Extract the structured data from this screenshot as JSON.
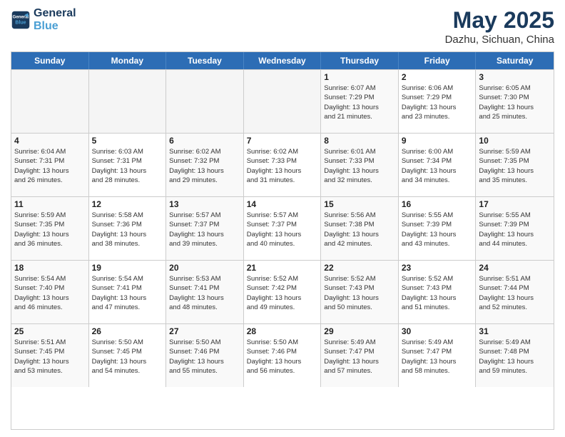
{
  "header": {
    "logo_line1": "General",
    "logo_line2": "Blue",
    "month_title": "May 2025",
    "location": "Dazhu, Sichuan, China"
  },
  "days_of_week": [
    "Sunday",
    "Monday",
    "Tuesday",
    "Wednesday",
    "Thursday",
    "Friday",
    "Saturday"
  ],
  "weeks": [
    [
      {
        "day": "",
        "empty": true,
        "info": ""
      },
      {
        "day": "",
        "empty": true,
        "info": ""
      },
      {
        "day": "",
        "empty": true,
        "info": ""
      },
      {
        "day": "",
        "empty": true,
        "info": ""
      },
      {
        "day": "1",
        "empty": false,
        "info": "Sunrise: 6:07 AM\nSunset: 7:29 PM\nDaylight: 13 hours\nand 21 minutes."
      },
      {
        "day": "2",
        "empty": false,
        "info": "Sunrise: 6:06 AM\nSunset: 7:29 PM\nDaylight: 13 hours\nand 23 minutes."
      },
      {
        "day": "3",
        "empty": false,
        "info": "Sunrise: 6:05 AM\nSunset: 7:30 PM\nDaylight: 13 hours\nand 25 minutes."
      }
    ],
    [
      {
        "day": "4",
        "empty": false,
        "info": "Sunrise: 6:04 AM\nSunset: 7:31 PM\nDaylight: 13 hours\nand 26 minutes."
      },
      {
        "day": "5",
        "empty": false,
        "info": "Sunrise: 6:03 AM\nSunset: 7:31 PM\nDaylight: 13 hours\nand 28 minutes."
      },
      {
        "day": "6",
        "empty": false,
        "info": "Sunrise: 6:02 AM\nSunset: 7:32 PM\nDaylight: 13 hours\nand 29 minutes."
      },
      {
        "day": "7",
        "empty": false,
        "info": "Sunrise: 6:02 AM\nSunset: 7:33 PM\nDaylight: 13 hours\nand 31 minutes."
      },
      {
        "day": "8",
        "empty": false,
        "info": "Sunrise: 6:01 AM\nSunset: 7:33 PM\nDaylight: 13 hours\nand 32 minutes."
      },
      {
        "day": "9",
        "empty": false,
        "info": "Sunrise: 6:00 AM\nSunset: 7:34 PM\nDaylight: 13 hours\nand 34 minutes."
      },
      {
        "day": "10",
        "empty": false,
        "info": "Sunrise: 5:59 AM\nSunset: 7:35 PM\nDaylight: 13 hours\nand 35 minutes."
      }
    ],
    [
      {
        "day": "11",
        "empty": false,
        "info": "Sunrise: 5:59 AM\nSunset: 7:35 PM\nDaylight: 13 hours\nand 36 minutes."
      },
      {
        "day": "12",
        "empty": false,
        "info": "Sunrise: 5:58 AM\nSunset: 7:36 PM\nDaylight: 13 hours\nand 38 minutes."
      },
      {
        "day": "13",
        "empty": false,
        "info": "Sunrise: 5:57 AM\nSunset: 7:37 PM\nDaylight: 13 hours\nand 39 minutes."
      },
      {
        "day": "14",
        "empty": false,
        "info": "Sunrise: 5:57 AM\nSunset: 7:37 PM\nDaylight: 13 hours\nand 40 minutes."
      },
      {
        "day": "15",
        "empty": false,
        "info": "Sunrise: 5:56 AM\nSunset: 7:38 PM\nDaylight: 13 hours\nand 42 minutes."
      },
      {
        "day": "16",
        "empty": false,
        "info": "Sunrise: 5:55 AM\nSunset: 7:39 PM\nDaylight: 13 hours\nand 43 minutes."
      },
      {
        "day": "17",
        "empty": false,
        "info": "Sunrise: 5:55 AM\nSunset: 7:39 PM\nDaylight: 13 hours\nand 44 minutes."
      }
    ],
    [
      {
        "day": "18",
        "empty": false,
        "info": "Sunrise: 5:54 AM\nSunset: 7:40 PM\nDaylight: 13 hours\nand 46 minutes."
      },
      {
        "day": "19",
        "empty": false,
        "info": "Sunrise: 5:54 AM\nSunset: 7:41 PM\nDaylight: 13 hours\nand 47 minutes."
      },
      {
        "day": "20",
        "empty": false,
        "info": "Sunrise: 5:53 AM\nSunset: 7:41 PM\nDaylight: 13 hours\nand 48 minutes."
      },
      {
        "day": "21",
        "empty": false,
        "info": "Sunrise: 5:52 AM\nSunset: 7:42 PM\nDaylight: 13 hours\nand 49 minutes."
      },
      {
        "day": "22",
        "empty": false,
        "info": "Sunrise: 5:52 AM\nSunset: 7:43 PM\nDaylight: 13 hours\nand 50 minutes."
      },
      {
        "day": "23",
        "empty": false,
        "info": "Sunrise: 5:52 AM\nSunset: 7:43 PM\nDaylight: 13 hours\nand 51 minutes."
      },
      {
        "day": "24",
        "empty": false,
        "info": "Sunrise: 5:51 AM\nSunset: 7:44 PM\nDaylight: 13 hours\nand 52 minutes."
      }
    ],
    [
      {
        "day": "25",
        "empty": false,
        "info": "Sunrise: 5:51 AM\nSunset: 7:45 PM\nDaylight: 13 hours\nand 53 minutes."
      },
      {
        "day": "26",
        "empty": false,
        "info": "Sunrise: 5:50 AM\nSunset: 7:45 PM\nDaylight: 13 hours\nand 54 minutes."
      },
      {
        "day": "27",
        "empty": false,
        "info": "Sunrise: 5:50 AM\nSunset: 7:46 PM\nDaylight: 13 hours\nand 55 minutes."
      },
      {
        "day": "28",
        "empty": false,
        "info": "Sunrise: 5:50 AM\nSunset: 7:46 PM\nDaylight: 13 hours\nand 56 minutes."
      },
      {
        "day": "29",
        "empty": false,
        "info": "Sunrise: 5:49 AM\nSunset: 7:47 PM\nDaylight: 13 hours\nand 57 minutes."
      },
      {
        "day": "30",
        "empty": false,
        "info": "Sunrise: 5:49 AM\nSunset: 7:47 PM\nDaylight: 13 hours\nand 58 minutes."
      },
      {
        "day": "31",
        "empty": false,
        "info": "Sunrise: 5:49 AM\nSunset: 7:48 PM\nDaylight: 13 hours\nand 59 minutes."
      }
    ]
  ]
}
